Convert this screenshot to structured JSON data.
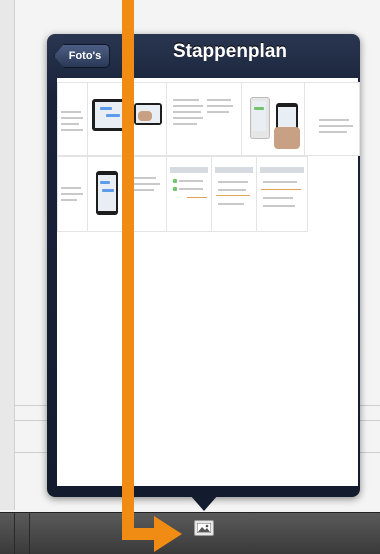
{
  "popover": {
    "back_label": "Foto's",
    "title": "Stappenplan"
  },
  "toolbar": {
    "photo_icon": "photo-icon"
  },
  "colors": {
    "nav_bar": "#1a2540",
    "annotation_arrow": "#f08c14",
    "toolbar": "#4a4a4a"
  }
}
